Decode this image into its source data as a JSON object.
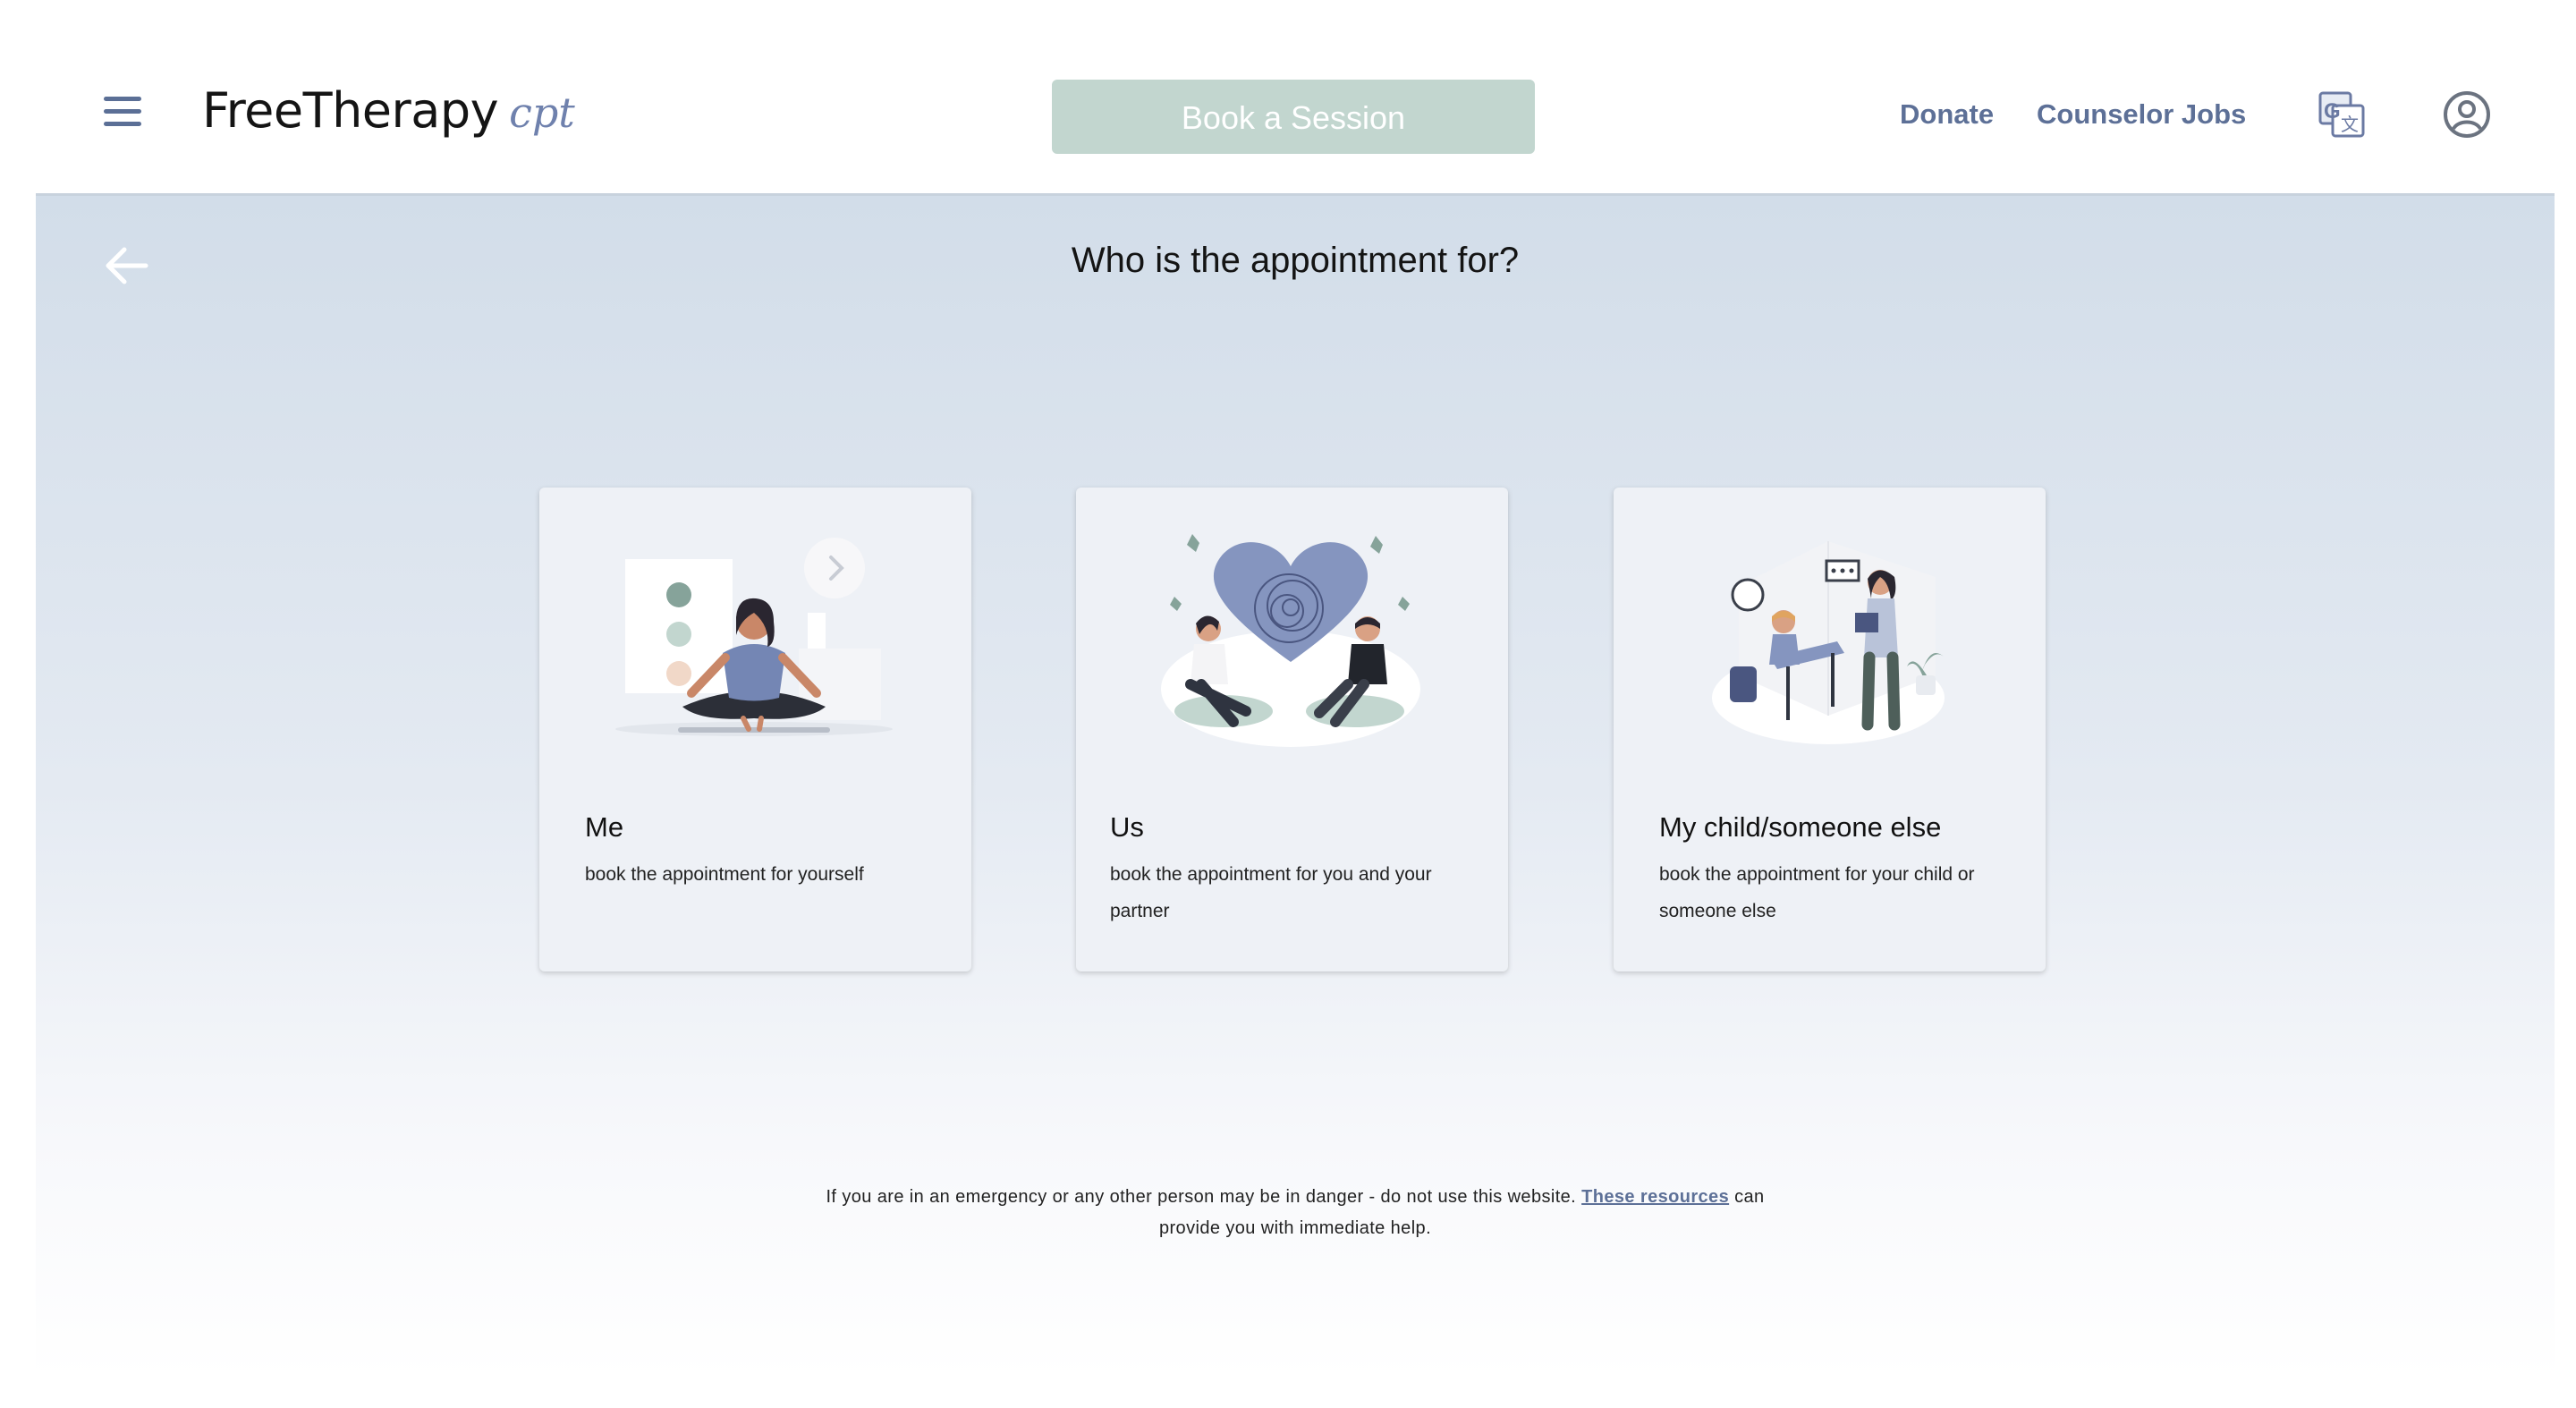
{
  "header": {
    "logo_main": "FreeTherapy",
    "logo_sub": "cpt",
    "book_button": "Book a Session",
    "nav": {
      "donate": "Donate",
      "counselor_jobs": "Counselor Jobs"
    }
  },
  "main": {
    "title": "Who is the appointment for?",
    "cards": [
      {
        "title": "Me",
        "description": "book the appointment for yourself"
      },
      {
        "title": "Us",
        "description": "book the appointment for you and your partner"
      },
      {
        "title": "My child/someone else",
        "description": "book the appointment for your child or someone else"
      }
    ]
  },
  "footer": {
    "text_before": "If you are in an emergency or any other person may be in danger - do not use this website.",
    "link_text": "These resources",
    "text_after": "can",
    "line2": "provide you with immediate help."
  },
  "colors": {
    "accent": "#5d7097",
    "book_button_bg": "#c2d6cf",
    "card_bg": "#eef1f6",
    "illustration_blue": "#8595bf",
    "illustration_green": "#86a39a"
  },
  "icons": [
    "hamburger-menu-icon",
    "translate-icon",
    "account-icon",
    "back-arrow-icon"
  ]
}
